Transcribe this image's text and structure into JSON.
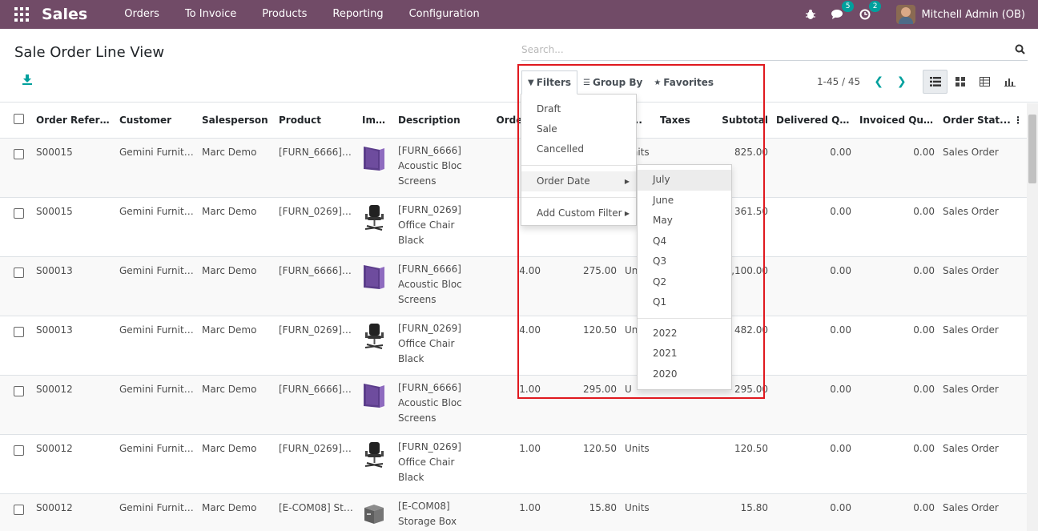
{
  "navbar": {
    "brand": "Sales",
    "menu": [
      "Orders",
      "To Invoice",
      "Products",
      "Reporting",
      "Configuration"
    ],
    "messages_count": "5",
    "activities_count": "2",
    "user_name": "Mitchell Admin (OB)",
    "color": "#714b67"
  },
  "control": {
    "title": "Sale Order Line View",
    "search_placeholder": "Search...",
    "filters_label": "Filters",
    "groupby_label": "Group By",
    "favorites_label": "Favorites",
    "pager": "1-45 / 45"
  },
  "filters_menu": {
    "items": [
      "Draft",
      "Sale",
      "Cancelled"
    ],
    "order_date": "Order Date",
    "add_custom": "Add Custom Filter"
  },
  "date_submenu": {
    "periods": [
      "July",
      "June",
      "May",
      "Q4",
      "Q3",
      "Q2",
      "Q1"
    ],
    "years": [
      "2022",
      "2021",
      "2020"
    ]
  },
  "table": {
    "headers": [
      "Order Refere...",
      "Customer",
      "Salesperson",
      "Product",
      "Image",
      "Description",
      "Ordered",
      "",
      "o...",
      "Taxes",
      "Subtotal",
      "Delivered Qu...",
      "Invoiced Qua...",
      "Order Stat..."
    ],
    "rows": [
      {
        "ref": "S00015",
        "customer": "Gemini Furnitu...",
        "salesperson": "Marc Demo",
        "product": "[FURN_6666] ...",
        "image": "panel",
        "desc1": "[FURN_6666]",
        "desc2": "Acoustic Bloc",
        "desc3": "Screens",
        "qty": "",
        "price": "",
        "uom": "Units",
        "subtotal": "825.00",
        "delivered": "0.00",
        "invoiced": "0.00",
        "status": "Sales Order"
      },
      {
        "ref": "S00015",
        "customer": "Gemini Furnitu...",
        "salesperson": "Marc Demo",
        "product": "[FURN_0269] ...",
        "image": "chair",
        "desc1": "[FURN_0269]",
        "desc2": "Office Chair",
        "desc3": "Black",
        "qty": "",
        "price": "",
        "uom": "",
        "subtotal": "361.50",
        "delivered": "0.00",
        "invoiced": "0.00",
        "status": "Sales Order"
      },
      {
        "ref": "S00013",
        "customer": "Gemini Furnitu...",
        "salesperson": "Marc Demo",
        "product": "[FURN_6666] ...",
        "image": "panel",
        "desc1": "[FURN_6666]",
        "desc2": "Acoustic Bloc",
        "desc3": "Screens",
        "qty": "4.00",
        "price": "275.00",
        "uom": "Un",
        "subtotal": "1,100.00",
        "delivered": "0.00",
        "invoiced": "0.00",
        "status": "Sales Order"
      },
      {
        "ref": "S00013",
        "customer": "Gemini Furnitu...",
        "salesperson": "Marc Demo",
        "product": "[FURN_0269] ...",
        "image": "chair",
        "desc1": "[FURN_0269]",
        "desc2": "Office Chair",
        "desc3": "Black",
        "qty": "4.00",
        "price": "120.50",
        "uom": "Un",
        "subtotal": "482.00",
        "delivered": "0.00",
        "invoiced": "0.00",
        "status": "Sales Order"
      },
      {
        "ref": "S00012",
        "customer": "Gemini Furnitu...",
        "salesperson": "Marc Demo",
        "product": "[FURN_6666] ...",
        "image": "panel",
        "desc1": "[FURN_6666]",
        "desc2": "Acoustic Bloc",
        "desc3": "Screens",
        "qty": "1.00",
        "price": "295.00",
        "uom": "U",
        "subtotal": "295.00",
        "delivered": "0.00",
        "invoiced": "0.00",
        "status": "Sales Order"
      },
      {
        "ref": "S00012",
        "customer": "Gemini Furnitu...",
        "salesperson": "Marc Demo",
        "product": "[FURN_0269] ...",
        "image": "chair",
        "desc1": "[FURN_0269]",
        "desc2": "Office Chair",
        "desc3": "Black",
        "qty": "1.00",
        "price": "120.50",
        "uom": "Units",
        "subtotal": "120.50",
        "delivered": "0.00",
        "invoiced": "0.00",
        "status": "Sales Order"
      },
      {
        "ref": "S00012",
        "customer": "Gemini Furnitu...",
        "salesperson": "Marc Demo",
        "product": "[E-COM08] Sto...",
        "image": "box",
        "desc1": "[E-COM08]",
        "desc2": "Storage Box",
        "desc3": "",
        "qty": "1.00",
        "price": "15.80",
        "uom": "Units",
        "subtotal": "15.80",
        "delivered": "0.00",
        "invoiced": "0.00",
        "status": "Sales Order"
      }
    ]
  },
  "highlight_color": "#e0191f",
  "accent_color": "#00a09d"
}
